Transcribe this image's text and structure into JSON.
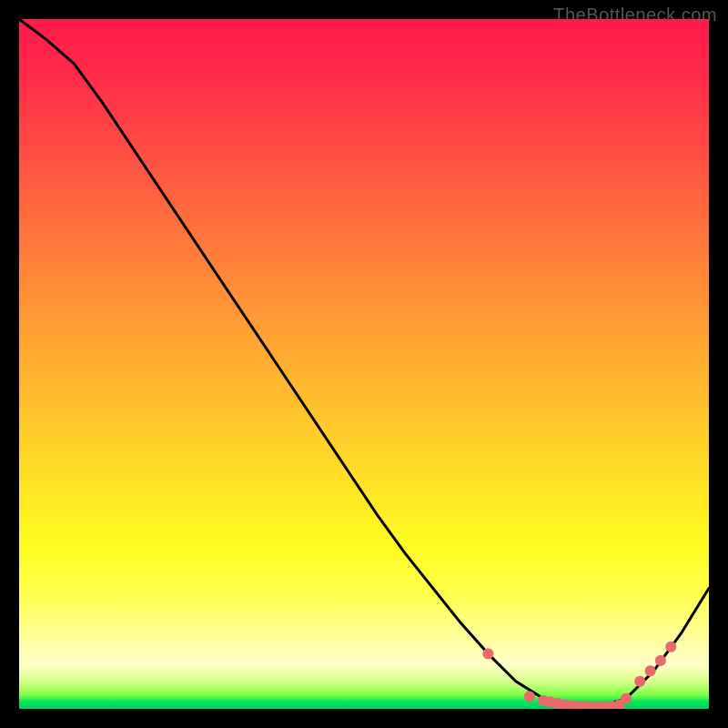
{
  "attribution": "TheBottleneck.com",
  "chart_data": {
    "type": "line",
    "title": "",
    "xlabel": "",
    "ylabel": "",
    "xlim": [
      0,
      100
    ],
    "ylim": [
      0,
      100
    ],
    "series": [
      {
        "name": "bottleneck-curve",
        "x": [
          0,
          4,
          8,
          12,
          16,
          20,
          24,
          28,
          32,
          36,
          40,
          44,
          48,
          52,
          56,
          60,
          64,
          68,
          72,
          76,
          80,
          84,
          88,
          92,
          96,
          100
        ],
        "y": [
          100,
          97,
          93.5,
          88,
          82,
          76,
          70,
          64,
          58,
          52,
          46,
          40,
          34,
          28,
          22.5,
          17.5,
          12.5,
          8,
          4,
          1.5,
          0.5,
          0.3,
          1.5,
          5.5,
          11,
          17.5
        ]
      }
    ],
    "markers": {
      "name": "curve-dots",
      "x": [
        68,
        74,
        76,
        77,
        78,
        79,
        80,
        81,
        82,
        83,
        84,
        85,
        86,
        87,
        88,
        90,
        91.5,
        93,
        94.5
      ],
      "y": [
        8,
        1.8,
        1.2,
        1.0,
        0.8,
        0.6,
        0.5,
        0.4,
        0.35,
        0.32,
        0.3,
        0.33,
        0.38,
        0.6,
        1.5,
        4.0,
        5.5,
        7.0,
        9.0
      ]
    },
    "gradient_stops": [
      {
        "pos": 0,
        "color": "#ff1a4d"
      },
      {
        "pos": 30,
        "color": "#ff7a3a"
      },
      {
        "pos": 60,
        "color": "#ffd628"
      },
      {
        "pos": 82,
        "color": "#ffff40"
      },
      {
        "pos": 94,
        "color": "#eaffb4"
      },
      {
        "pos": 100,
        "color": "#00d060"
      }
    ]
  }
}
